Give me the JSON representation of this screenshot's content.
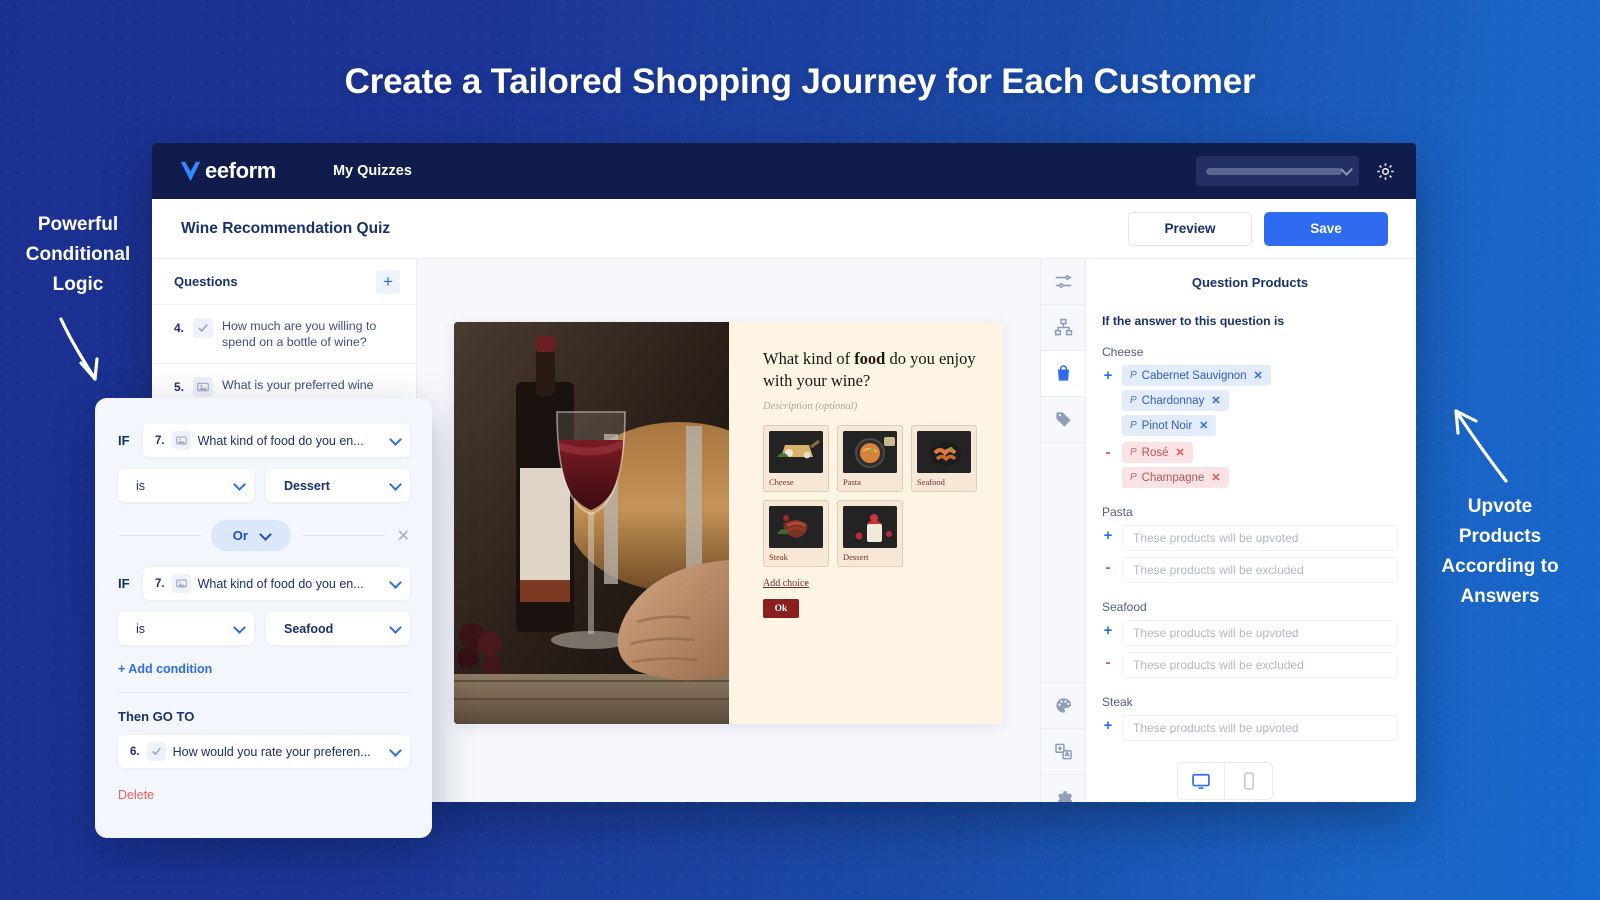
{
  "hero": {
    "title": "Create a Tailored Shopping Journey for Each Customer"
  },
  "callouts": {
    "left": "Powerful\nConditional\nLogic",
    "left_lines": [
      "Powerful",
      "Conditional",
      "Logic"
    ],
    "right_lines": [
      "Upvote",
      "Products",
      "According to",
      "Answers"
    ]
  },
  "topbar": {
    "brand": "eeform",
    "nav_my_quizzes": "My Quizzes",
    "account_value": "",
    "gear_icon": "gear-icon",
    "chevron_icon": "chevron-down-icon"
  },
  "subheader": {
    "quiz_title": "Wine Recommendation Quiz",
    "preview_label": "Preview",
    "save_label": "Save"
  },
  "questions_panel": {
    "heading": "Questions",
    "add_label": "+",
    "items": [
      {
        "num": "4.",
        "icon": "check-icon",
        "label": "How much are you willing to spend on a bottle of wine?"
      },
      {
        "num": "5.",
        "icon": "image-icon",
        "label": "What is your preferred wine"
      }
    ]
  },
  "preview": {
    "question_part1": "What kind of ",
    "question_bold": "food",
    "question_part2": " do you enjoy with your wine?",
    "description": "Description (optional)",
    "choices": [
      "Cheese",
      "Pasta",
      "Seafood",
      "Steak",
      "Dessert"
    ],
    "add_choice": "Add choice",
    "ok_label": "Ok",
    "device_desktop_icon": "desktop-icon",
    "device_mobile_icon": "mobile-icon"
  },
  "icon_rail": [
    {
      "name": "sliders-icon",
      "active": false
    },
    {
      "name": "sitemap-icon",
      "active": false
    },
    {
      "name": "shopping-bag-icon",
      "active": true
    },
    {
      "name": "tag-icon",
      "active": false
    },
    {
      "name": "palette-icon",
      "active": false
    },
    {
      "name": "translate-icon",
      "active": false
    },
    {
      "name": "gear-icon",
      "active": false
    }
  ],
  "products_panel": {
    "title": "Question Products",
    "subtitle": "If the answer to this question is",
    "upvoted_placeholder": "These products will be upvoted",
    "excluded_placeholder": "These products will be excluded",
    "groups": [
      {
        "name": "Cheese",
        "upvoted": [
          "Cabernet Sauvignon",
          "Chardonnay",
          "Pinot Noir"
        ],
        "excluded": [
          "Rosé",
          "Champagne"
        ]
      },
      {
        "name": "Pasta",
        "upvoted": [],
        "excluded": []
      },
      {
        "name": "Seafood",
        "upvoted": [],
        "excluded": []
      },
      {
        "name": "Steak",
        "upvoted": [],
        "excluded": []
      }
    ]
  },
  "logic_card": {
    "if_label": "IF",
    "condition1": {
      "question_num": "7.",
      "question_text": "What kind of food do you en...",
      "operator": "is",
      "value": "Dessert"
    },
    "connector": "Or",
    "condition2": {
      "question_num": "7.",
      "question_text": "What kind of food do you en...",
      "operator": "is",
      "value": "Seafood"
    },
    "add_condition": "+ Add condition",
    "then_goto_label": "Then GO TO",
    "goto": {
      "num": "6.",
      "text": "How would you rate your preferen..."
    },
    "delete_label": "Delete"
  },
  "colors": {
    "page_blue": "#1d3394",
    "accent_blue": "#2f6bf0",
    "navy": "#101c4b",
    "danger_red": "#ef5d5d",
    "wine_red": "#8a1f1f",
    "cream": "#fdf4e3"
  }
}
